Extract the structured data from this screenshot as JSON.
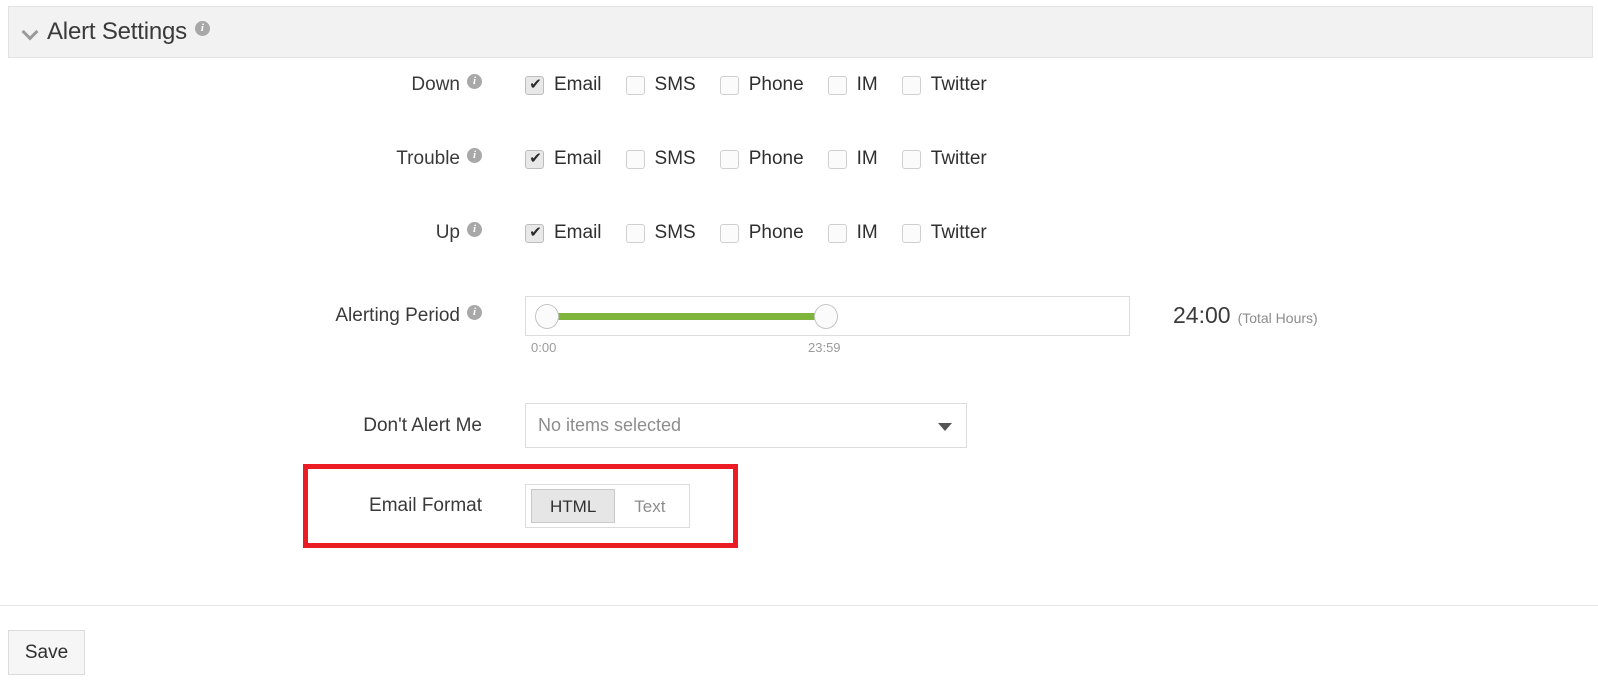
{
  "panel": {
    "title": "Alert Settings",
    "chevron_icon": "chevron-down-icon",
    "info_icon": "info-icon",
    "collapsed": false
  },
  "alert_rows": [
    {
      "label": "Down",
      "has_info": true,
      "channels": [
        {
          "label": "Email",
          "checked": true
        },
        {
          "label": "SMS",
          "checked": false
        },
        {
          "label": "Phone",
          "checked": false
        },
        {
          "label": "IM",
          "checked": false
        },
        {
          "label": "Twitter",
          "checked": false
        }
      ]
    },
    {
      "label": "Trouble",
      "has_info": true,
      "channels": [
        {
          "label": "Email",
          "checked": true
        },
        {
          "label": "SMS",
          "checked": false
        },
        {
          "label": "Phone",
          "checked": false
        },
        {
          "label": "IM",
          "checked": false
        },
        {
          "label": "Twitter",
          "checked": false
        }
      ]
    },
    {
      "label": "Up",
      "has_info": true,
      "channels": [
        {
          "label": "Email",
          "checked": true
        },
        {
          "label": "SMS",
          "checked": false
        },
        {
          "label": "Phone",
          "checked": false
        },
        {
          "label": "IM",
          "checked": false
        },
        {
          "label": "Twitter",
          "checked": false
        }
      ]
    }
  ],
  "alerting_period": {
    "label": "Alerting Period",
    "has_info": true,
    "start_time": "0:00",
    "end_time": "23:59",
    "total_value": "24:00",
    "total_unit": "(Total Hours)",
    "track_color": "#80b53d"
  },
  "dont_alert_me": {
    "label": "Don't Alert Me",
    "placeholder": "No items selected",
    "value": "No items selected",
    "caret_icon": "chevron-down-icon"
  },
  "email_format": {
    "label": "Email Format",
    "options": [
      "HTML",
      "Text"
    ],
    "selected": "HTML",
    "highlight_color": "#ec1c24"
  },
  "footer": {
    "save_label": "Save"
  }
}
